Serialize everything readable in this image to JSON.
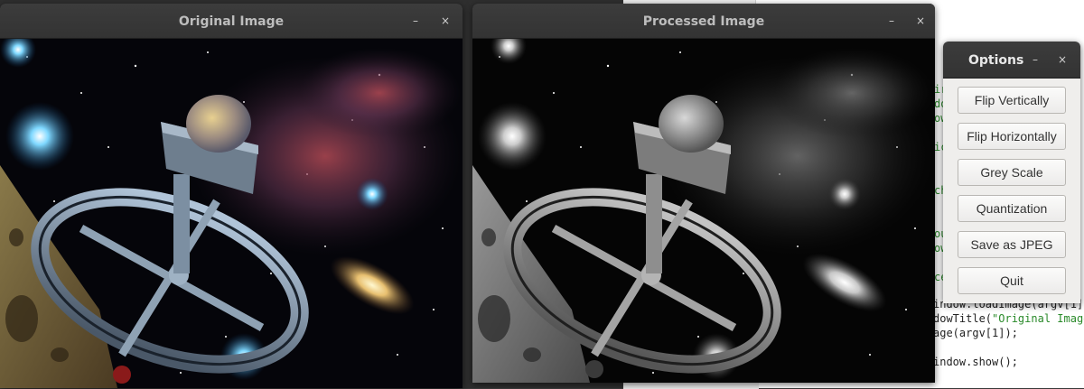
{
  "windows": {
    "original": {
      "title": "Original Image",
      "minimize_glyph": "–",
      "close_glyph": "×"
    },
    "processed": {
      "title": "Processed Image",
      "minimize_glyph": "–",
      "close_glyph": "×"
    }
  },
  "options": {
    "title": "Options",
    "minimize_glyph": "–",
    "close_glyph": "×",
    "buttons": [
      "Flip Vertically",
      "Flip Horizontally",
      "Grey Scale",
      "Quantization",
      "Save as JPEG",
      "Quit"
    ]
  },
  "editor": {
    "lines": {
      "load": "indow.loadImage(argv[1]",
      "title_prefix": "dowTitle(",
      "title_string": "\"Original Image",
      "image": "age(argv[1]);",
      "show": "indow.show();"
    }
  },
  "icons": {
    "minimize": "minimize-icon",
    "close": "close-icon"
  },
  "colors": {
    "titlebar": "#363636",
    "title_text": "#bdbdbd",
    "dialog_bg": "#efeeec",
    "button_border": "#b9b7b3",
    "code_string": "#2a8a2a"
  }
}
